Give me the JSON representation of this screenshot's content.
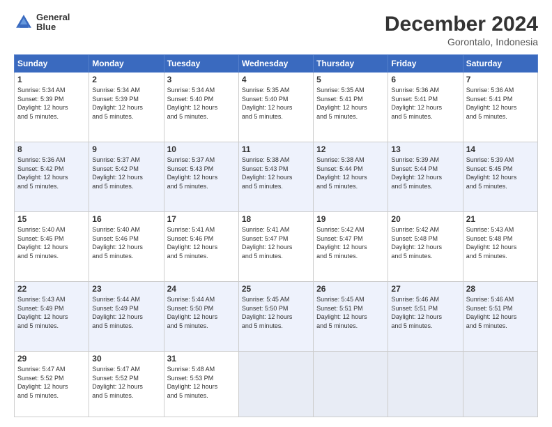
{
  "header": {
    "logo_line1": "General",
    "logo_line2": "Blue",
    "title": "December 2024",
    "subtitle": "Gorontalo, Indonesia"
  },
  "weekdays": [
    "Sunday",
    "Monday",
    "Tuesday",
    "Wednesday",
    "Thursday",
    "Friday",
    "Saturday"
  ],
  "weeks": [
    [
      {
        "day": "1",
        "lines": [
          "Sunrise: 5:34 AM",
          "Sunset: 5:39 PM",
          "Daylight: 12 hours",
          "and 5 minutes."
        ]
      },
      {
        "day": "2",
        "lines": [
          "Sunrise: 5:34 AM",
          "Sunset: 5:39 PM",
          "Daylight: 12 hours",
          "and 5 minutes."
        ]
      },
      {
        "day": "3",
        "lines": [
          "Sunrise: 5:34 AM",
          "Sunset: 5:40 PM",
          "Daylight: 12 hours",
          "and 5 minutes."
        ]
      },
      {
        "day": "4",
        "lines": [
          "Sunrise: 5:35 AM",
          "Sunset: 5:40 PM",
          "Daylight: 12 hours",
          "and 5 minutes."
        ]
      },
      {
        "day": "5",
        "lines": [
          "Sunrise: 5:35 AM",
          "Sunset: 5:41 PM",
          "Daylight: 12 hours",
          "and 5 minutes."
        ]
      },
      {
        "day": "6",
        "lines": [
          "Sunrise: 5:36 AM",
          "Sunset: 5:41 PM",
          "Daylight: 12 hours",
          "and 5 minutes."
        ]
      },
      {
        "day": "7",
        "lines": [
          "Sunrise: 5:36 AM",
          "Sunset: 5:41 PM",
          "Daylight: 12 hours",
          "and 5 minutes."
        ]
      }
    ],
    [
      {
        "day": "8",
        "lines": [
          "Sunrise: 5:36 AM",
          "Sunset: 5:42 PM",
          "Daylight: 12 hours",
          "and 5 minutes."
        ]
      },
      {
        "day": "9",
        "lines": [
          "Sunrise: 5:37 AM",
          "Sunset: 5:42 PM",
          "Daylight: 12 hours",
          "and 5 minutes."
        ]
      },
      {
        "day": "10",
        "lines": [
          "Sunrise: 5:37 AM",
          "Sunset: 5:43 PM",
          "Daylight: 12 hours",
          "and 5 minutes."
        ]
      },
      {
        "day": "11",
        "lines": [
          "Sunrise: 5:38 AM",
          "Sunset: 5:43 PM",
          "Daylight: 12 hours",
          "and 5 minutes."
        ]
      },
      {
        "day": "12",
        "lines": [
          "Sunrise: 5:38 AM",
          "Sunset: 5:44 PM",
          "Daylight: 12 hours",
          "and 5 minutes."
        ]
      },
      {
        "day": "13",
        "lines": [
          "Sunrise: 5:39 AM",
          "Sunset: 5:44 PM",
          "Daylight: 12 hours",
          "and 5 minutes."
        ]
      },
      {
        "day": "14",
        "lines": [
          "Sunrise: 5:39 AM",
          "Sunset: 5:45 PM",
          "Daylight: 12 hours",
          "and 5 minutes."
        ]
      }
    ],
    [
      {
        "day": "15",
        "lines": [
          "Sunrise: 5:40 AM",
          "Sunset: 5:45 PM",
          "Daylight: 12 hours",
          "and 5 minutes."
        ]
      },
      {
        "day": "16",
        "lines": [
          "Sunrise: 5:40 AM",
          "Sunset: 5:46 PM",
          "Daylight: 12 hours",
          "and 5 minutes."
        ]
      },
      {
        "day": "17",
        "lines": [
          "Sunrise: 5:41 AM",
          "Sunset: 5:46 PM",
          "Daylight: 12 hours",
          "and 5 minutes."
        ]
      },
      {
        "day": "18",
        "lines": [
          "Sunrise: 5:41 AM",
          "Sunset: 5:47 PM",
          "Daylight: 12 hours",
          "and 5 minutes."
        ]
      },
      {
        "day": "19",
        "lines": [
          "Sunrise: 5:42 AM",
          "Sunset: 5:47 PM",
          "Daylight: 12 hours",
          "and 5 minutes."
        ]
      },
      {
        "day": "20",
        "lines": [
          "Sunrise: 5:42 AM",
          "Sunset: 5:48 PM",
          "Daylight: 12 hours",
          "and 5 minutes."
        ]
      },
      {
        "day": "21",
        "lines": [
          "Sunrise: 5:43 AM",
          "Sunset: 5:48 PM",
          "Daylight: 12 hours",
          "and 5 minutes."
        ]
      }
    ],
    [
      {
        "day": "22",
        "lines": [
          "Sunrise: 5:43 AM",
          "Sunset: 5:49 PM",
          "Daylight: 12 hours",
          "and 5 minutes."
        ]
      },
      {
        "day": "23",
        "lines": [
          "Sunrise: 5:44 AM",
          "Sunset: 5:49 PM",
          "Daylight: 12 hours",
          "and 5 minutes."
        ]
      },
      {
        "day": "24",
        "lines": [
          "Sunrise: 5:44 AM",
          "Sunset: 5:50 PM",
          "Daylight: 12 hours",
          "and 5 minutes."
        ]
      },
      {
        "day": "25",
        "lines": [
          "Sunrise: 5:45 AM",
          "Sunset: 5:50 PM",
          "Daylight: 12 hours",
          "and 5 minutes."
        ]
      },
      {
        "day": "26",
        "lines": [
          "Sunrise: 5:45 AM",
          "Sunset: 5:51 PM",
          "Daylight: 12 hours",
          "and 5 minutes."
        ]
      },
      {
        "day": "27",
        "lines": [
          "Sunrise: 5:46 AM",
          "Sunset: 5:51 PM",
          "Daylight: 12 hours",
          "and 5 minutes."
        ]
      },
      {
        "day": "28",
        "lines": [
          "Sunrise: 5:46 AM",
          "Sunset: 5:51 PM",
          "Daylight: 12 hours",
          "and 5 minutes."
        ]
      }
    ],
    [
      {
        "day": "29",
        "lines": [
          "Sunrise: 5:47 AM",
          "Sunset: 5:52 PM",
          "Daylight: 12 hours",
          "and 5 minutes."
        ]
      },
      {
        "day": "30",
        "lines": [
          "Sunrise: 5:47 AM",
          "Sunset: 5:52 PM",
          "Daylight: 12 hours",
          "and 5 minutes."
        ]
      },
      {
        "day": "31",
        "lines": [
          "Sunrise: 5:48 AM",
          "Sunset: 5:53 PM",
          "Daylight: 12 hours",
          "and 5 minutes."
        ]
      },
      null,
      null,
      null,
      null
    ]
  ]
}
